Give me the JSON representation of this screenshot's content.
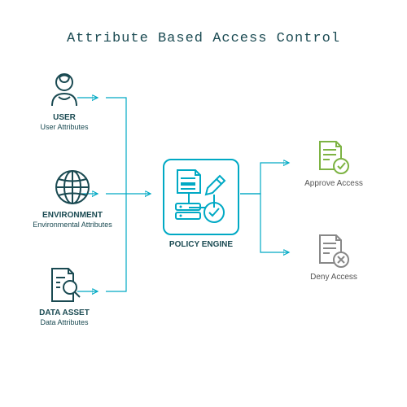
{
  "title": "Attribute Based Access Control",
  "nodes": {
    "user": {
      "label": "USER",
      "sub": "User Attributes"
    },
    "environment": {
      "label": "ENVIRONMENT",
      "sub": "Environmental Attributes"
    },
    "data_asset": {
      "label": "DATA ASSET",
      "sub": "Data Attributes"
    },
    "policy": {
      "label": "POLICY ENGINE"
    },
    "approve": {
      "label": "Approve Access"
    },
    "deny": {
      "label": "Deny Access"
    }
  },
  "colors": {
    "primary_dark": "#1a4a52",
    "accent": "#00a9c4",
    "approve": "#7db343",
    "deny": "#888888"
  }
}
